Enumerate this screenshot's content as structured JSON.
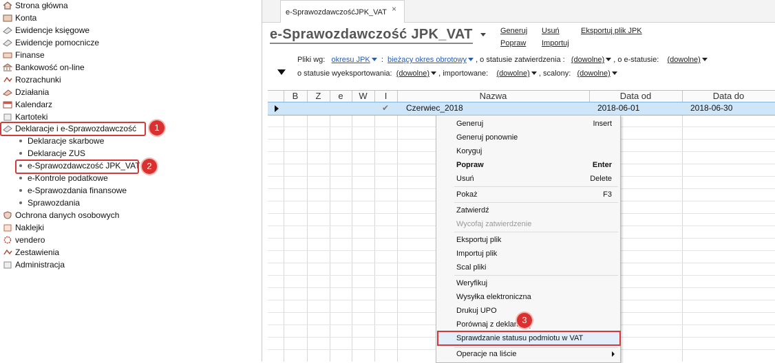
{
  "nav": {
    "items": [
      {
        "label": "Strona główna",
        "icon": "home-icon"
      },
      {
        "label": "Konta",
        "icon": "accounts-icon"
      },
      {
        "label": "Ewidencje księgowe",
        "icon": "ledger-icon"
      },
      {
        "label": "Ewidencje pomocnicze",
        "icon": "aux-ledger-icon"
      },
      {
        "label": "Finanse",
        "icon": "finance-icon"
      },
      {
        "label": "Bankowość on-line",
        "icon": "bank-icon"
      },
      {
        "label": "Rozrachunki",
        "icon": "settlements-icon"
      },
      {
        "label": "Działania",
        "icon": "actions-icon"
      },
      {
        "label": "Kalendarz",
        "icon": "calendar-icon"
      },
      {
        "label": "Kartoteki",
        "icon": "files-icon"
      },
      {
        "label": "Deklaracje i e-Sprawozdawczość",
        "icon": "declarations-icon"
      }
    ],
    "subitems": [
      "Deklaracje skarbowe",
      "Deklaracje ZUS",
      "e-Sprawozdawczość JPK_VAT",
      "e-Kontrole podatkowe",
      "e-Sprawozdania finansowe",
      "Sprawozdania"
    ],
    "items_after": [
      {
        "label": "Ochrona danych osobowych",
        "icon": "shield-icon"
      },
      {
        "label": "Naklejki",
        "icon": "sticker-icon"
      },
      {
        "label": "vendero",
        "icon": "vendero-icon"
      },
      {
        "label": "Zestawienia",
        "icon": "reports-icon"
      },
      {
        "label": "Administracja",
        "icon": "admin-icon"
      }
    ]
  },
  "badges": [
    "1",
    "2",
    "3"
  ],
  "tab": {
    "label": "e-SprawozdawczośćJPK_VAT",
    "close": "×"
  },
  "page": {
    "title": "e-Sprawozdawczość JPK_VAT"
  },
  "toolbar": {
    "generuj": "Generuj",
    "usun": "Usuń",
    "eksportuj": "Eksportuj plik JPK",
    "popraw": "Popraw",
    "importuj": "Importuj"
  },
  "filters": {
    "pliki_wg": "Pliki wg:",
    "okresu": "okresu JPK",
    "okres_obrotowy": "bieżący okres obrotowy",
    "status_zatw_label": ", o statusie zatwierdzenia :",
    "status_zatw_value": "(dowolne)",
    "estatus_label": ", o e-statusie:",
    "estatus_value": "(dowolne)",
    "wyeksp_label": "o statusie wyeksportowania:",
    "wyeksp_value": "(dowolne)",
    "import_label": ", importowane:",
    "import_value": "(dowolne)",
    "scalony_label": ", scalony:",
    "scalony_value": "(dowolne)"
  },
  "table": {
    "columns": [
      "B",
      "Z",
      "e",
      "W",
      "I",
      "Nazwa",
      "Data od",
      "Data do"
    ],
    "rows": [
      {
        "check": "✔",
        "nazwa": "Czerwiec_2018",
        "data_od": "2018-06-01",
        "data_do": "2018-06-30"
      }
    ]
  },
  "context_menu": {
    "items": [
      {
        "label": "Generuj",
        "shortcut": "Insert"
      },
      {
        "label": "Generuj ponownie",
        "shortcut": ""
      },
      {
        "label": "Koryguj",
        "shortcut": ""
      },
      {
        "label": "Popraw",
        "shortcut": "Enter"
      },
      {
        "label": "Usuń",
        "shortcut": "Delete"
      },
      {
        "label": "Pokaż",
        "shortcut": "F3"
      },
      {
        "label": "Zatwierdź",
        "shortcut": ""
      },
      {
        "label": "Wycofaj zatwierdzenie",
        "shortcut": ""
      },
      {
        "label": "Eksportuj plik",
        "shortcut": ""
      },
      {
        "label": "Importuj plik",
        "shortcut": ""
      },
      {
        "label": "Scal pliki",
        "shortcut": ""
      },
      {
        "label": "Weryfikuj",
        "shortcut": ""
      },
      {
        "label": "Wysyłka elektroniczna",
        "shortcut": ""
      },
      {
        "label": "Drukuj UPO",
        "shortcut": ""
      },
      {
        "label": "Porównaj z deklaracją",
        "shortcut": ""
      },
      {
        "label": "Sprawdzanie statusu podmiotu w VAT",
        "shortcut": ""
      },
      {
        "label": "Operacje na liście",
        "shortcut": ""
      }
    ]
  },
  "colors": {
    "highlight": "#d23a3a",
    "selection": "#cfe6f8",
    "link": "#2a5db0"
  }
}
